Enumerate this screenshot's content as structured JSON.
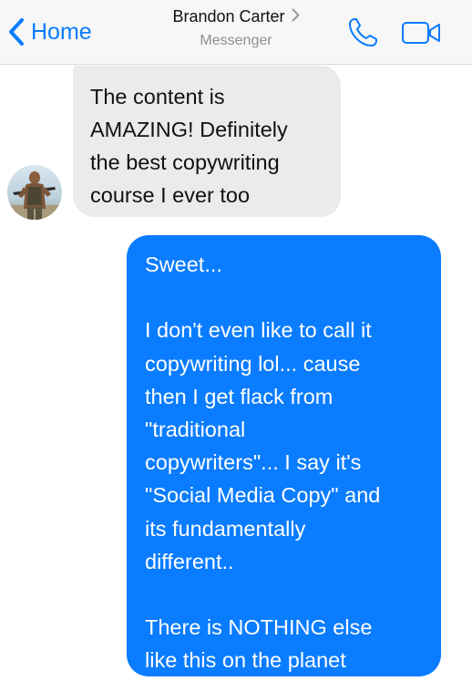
{
  "header": {
    "back_label": "Home",
    "contact_name": "Brandon Carter",
    "subtitle": "Messenger",
    "back_icon": "chevron-left-icon",
    "name_chevron_icon": "chevron-right-icon",
    "call_icon": "phone-icon",
    "video_icon": "video-camera-icon"
  },
  "colors": {
    "accent": "#0a7cff",
    "incoming_bubble": "#ebebeb",
    "header_bg": "#f7f7f7"
  },
  "messages": [
    {
      "direction": "incoming",
      "text": "The content is\nAMAZING! Definitely\nthe best copywriting\ncourse I ever too"
    },
    {
      "direction": "outgoing",
      "text": "Sweet...\n\nI don't even like to call it\ncopywriting lol... cause\nthen I get flack from\n\"traditional\ncopywriters\"... I say it's\n\"Social Media Copy\" and\nits fundamentally\ndifferent..\n\nThere is NOTHING else\nlike this on the planet"
    }
  ]
}
